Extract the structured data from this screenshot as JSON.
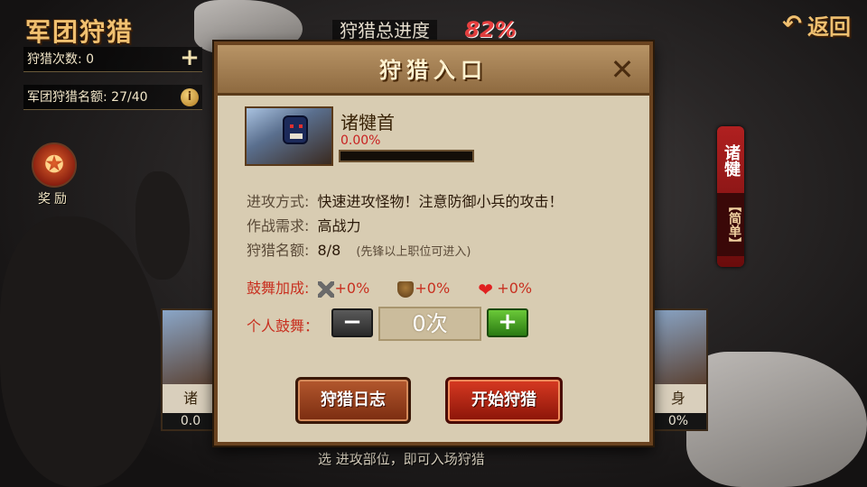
{
  "header": {
    "title": "军团狩猎",
    "back_label": "返回"
  },
  "stats": {
    "hunt_count_label": "狩猎次数:",
    "hunt_count_value": "0",
    "quota_label": "军团狩猎名额:",
    "quota_value": "27/40"
  },
  "reward": {
    "label": "奖励"
  },
  "overall_progress": {
    "label": "狩猎总进度",
    "value": "82%"
  },
  "boss_tag": {
    "name": "诸犍",
    "difficulty": "【简单】"
  },
  "side_cards": [
    {
      "name": "诸",
      "progress_text": "0.0"
    },
    {
      "name": "身",
      "progress_text": "0%"
    }
  ],
  "bottom_hint": "选 进攻部位，即可入场狩猎",
  "modal": {
    "title": "狩猎入口",
    "boss": {
      "part_name": "诸犍首",
      "progress_text": "0.00%",
      "progress": 0.0
    },
    "attack_label": "进攻方式:",
    "attack_value": "快速进攻怪物！注意防御小兵的攻击！",
    "requirement_label": "作战需求:",
    "requirement_value": "高战力",
    "quota_label": "狩猎名额:",
    "quota_value": "8/8",
    "quota_note": "(先锋以上职位可进入)",
    "boost_label": "鼓舞加成:",
    "boosts": [
      {
        "icon": "sword-icon",
        "value": "+0%"
      },
      {
        "icon": "shield-icon",
        "value": "+0%"
      },
      {
        "icon": "heart-icon",
        "value": "+0%"
      }
    ],
    "personal_label": "个人鼓舞：",
    "personal_count": "0次",
    "log_button": "狩猎日志",
    "start_button": "开始狩猎"
  },
  "colors": {
    "title_gold": "#f0c070",
    "alert_red": "#c83020",
    "start_red": "#d83a22",
    "plus_green": "#6ac838"
  }
}
